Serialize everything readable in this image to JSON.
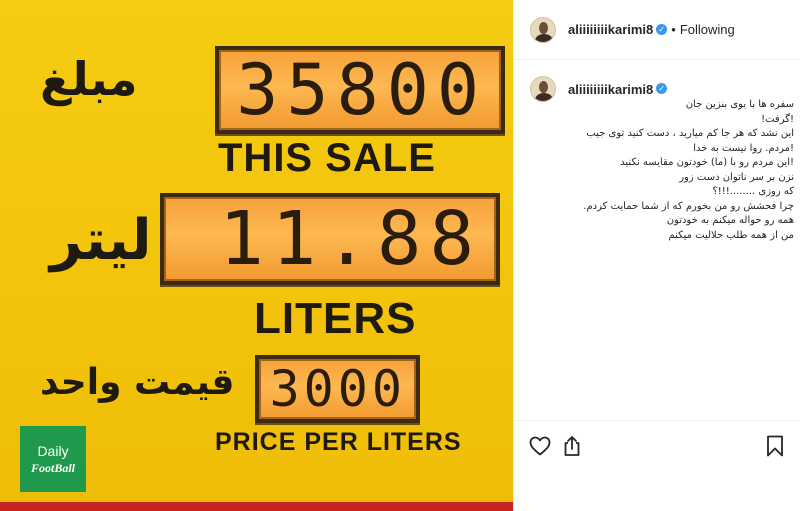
{
  "photo": {
    "display_amount": {
      "fa_label": "مبلغ",
      "digits": "35800",
      "en_label": "THIS SALE"
    },
    "display_liters": {
      "fa_label": "لیتر",
      "digits": "11.88",
      "en_label": "LITERS"
    },
    "display_price": {
      "fa_label": "قیمت واحد",
      "digits": "3000",
      "en_label": "PRICE PER LITERS"
    },
    "watermark": {
      "line1": "Daily",
      "line2": "FootBall"
    }
  },
  "header": {
    "username": "aliiiiiiiikarimi8",
    "verified": true,
    "separator": "•",
    "follow_state": "Following"
  },
  "caption": {
    "username": "aliiiiiiiikarimi8",
    "lines": [
      "سفره ها با بوی بنزین جان",
      "!گرفت!",
      "این نشد که هر جا کم میارید ، دست کنید توی جیب",
      "!مردم. روا نیست به خدا",
      "!این مردم رو با (ما) خودتون مقایسه نکنید",
      "نزن بر سر ناتوان دست زور",
      "که روزی ........!!!؟",
      "چرا فحشش رو من بخورم که از شما حمایت کردم.",
      "همه رو حواله میکنم به خودتون",
      "من از همه طلب حلالیت میکنم"
    ]
  },
  "actions": {
    "like_icon": "heart-icon",
    "share_icon": "share-icon",
    "save_icon": "bookmark-icon"
  },
  "colors": {
    "verified_badge": "#3897f0",
    "photo_background": "#f3c40b",
    "display_background": "#fdb850",
    "watermark_background": "#1f9a4c"
  }
}
